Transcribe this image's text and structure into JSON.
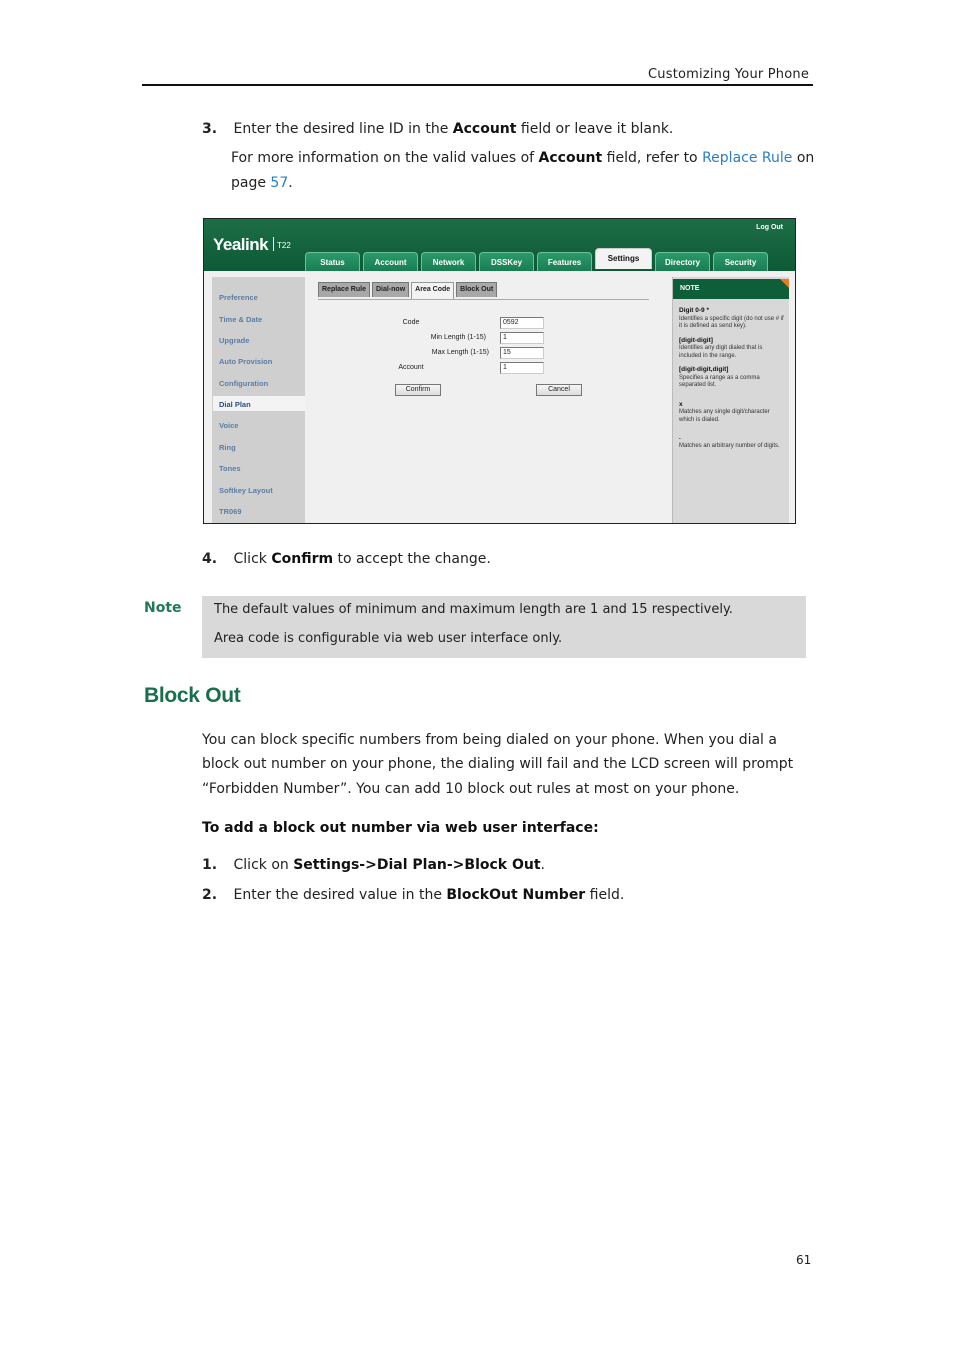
{
  "header": {
    "title": "Customizing  Your  Phone"
  },
  "step3": {
    "number": "3.",
    "line1_pre": "Enter the desired line ID in the ",
    "line1_bold": "Account",
    "line1_post": " field or leave it blank.",
    "line2_pre": "For more information on the valid values of ",
    "line2_bold": "Account",
    "line2_mid": " field, refer to ",
    "line2_link": "Replace Rule",
    "line2_post": " on",
    "line3_pre": "page ",
    "line3_link": "57",
    "line3_post": "."
  },
  "screenshot": {
    "logo": "Yealink",
    "model": "T22",
    "logout": "Log Out",
    "tabs": [
      {
        "label": "Status",
        "active": false
      },
      {
        "label": "Account",
        "active": false
      },
      {
        "label": "Network",
        "active": false
      },
      {
        "label": "DSSKey",
        "active": false
      },
      {
        "label": "Features",
        "active": false
      },
      {
        "label": "Settings",
        "active": true
      },
      {
        "label": "Directory",
        "active": false
      },
      {
        "label": "Security",
        "active": false
      }
    ],
    "sidebar": [
      {
        "label": "Preference"
      },
      {
        "label": "Time & Date"
      },
      {
        "label": "Upgrade"
      },
      {
        "label": "Auto Provision"
      },
      {
        "label": "Configuration"
      },
      {
        "label": "Dial Plan",
        "active": true
      },
      {
        "label": "Voice"
      },
      {
        "label": "Ring"
      },
      {
        "label": "Tones"
      },
      {
        "label": "Softkey Layout"
      },
      {
        "label": "TR069"
      }
    ],
    "subtabs": [
      {
        "label": "Replace Rule",
        "active": false
      },
      {
        "label": "Dial-now",
        "active": false
      },
      {
        "label": "Area Code",
        "active": true
      },
      {
        "label": "Block Out",
        "active": false
      }
    ],
    "fields": [
      {
        "label": "Code",
        "value": "0592"
      },
      {
        "label": "Min Length (1-15)",
        "value": "1"
      },
      {
        "label": "Max Length (1-15)",
        "value": "15"
      },
      {
        "label": "Account",
        "value": "1"
      }
    ],
    "confirm_label": "Confirm",
    "cancel_label": "Cancel",
    "note": {
      "title": "NOTE",
      "entries": [
        {
          "term": "Digit 0-9 *",
          "desc": "Identifies a specific digit (do not use # if it is defined as send key)."
        },
        {
          "term": "[digit-digit]",
          "desc": "Identifies any digit dialed that is included in the range."
        },
        {
          "term": "[digit-digit,digit]",
          "desc": "Specifies a range as a comma separated list."
        },
        {
          "term": "x",
          "desc": "Matches any single digit/character which is dialed."
        },
        {
          "term": ".",
          "desc": "Matches an arbitrary number of digits."
        }
      ]
    }
  },
  "step4": {
    "number": "4.",
    "pre": "Click ",
    "bold": "Confirm",
    "post": " to accept the change."
  },
  "note": {
    "label": "Note",
    "line1": "The default  values of minimum and maximum  length are 1 and 15 respectively.",
    "line2": "Area code is configurable  via web user interface  only."
  },
  "section": {
    "title": "Block Out",
    "para1": "You can block specific numbers from being dialed on your phone. When you dial a",
    "para2": "block out number on your phone, the dialing will fail and the LCD screen will prompt",
    "para3": "“Forbidden Number”. You can add 10 block out rules at most on your phone.",
    "procedure_heading": "To add a block out number via web user interface:",
    "steps": [
      {
        "number": "1.",
        "pre": "Click on ",
        "bold": "Settings->Dial Plan->Block Out",
        "post": "."
      },
      {
        "number": "2.",
        "pre": "Enter the desired value in the ",
        "bold": "BlockOut Number",
        "post": " field."
      }
    ]
  },
  "footer": {
    "page_number": "61"
  },
  "colors": {
    "heading_green": "#1a6e4e",
    "link_blue": "#2a7fc1",
    "yealink_green": "#0f5e3a",
    "note_orange": "#e87d1e",
    "note_bg": "#d9d9d9"
  }
}
